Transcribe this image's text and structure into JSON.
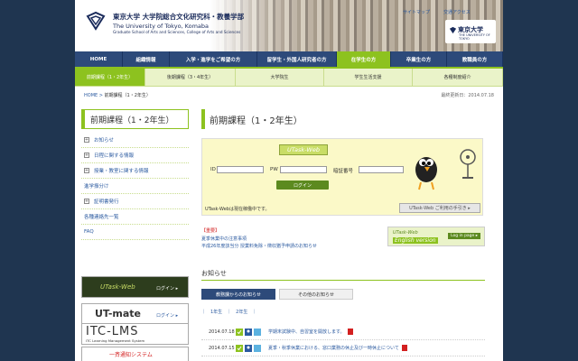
{
  "header": {
    "title_jp": "東京大学 大学院総合文化研究科・教養学部",
    "title_en": "The University of Tokyo, Komaba",
    "subtitle": "Graduate School of Arts and Sciences, College of Arts and Sciences",
    "sitemap": "サイトマップ",
    "access": "交通アクセス",
    "ut_logo": "東京大学",
    "ut_logo_sub": "THE UNIVERSITY OF TOKYO"
  },
  "nav": [
    "HOME",
    "組織情報",
    "入学・進学をご希望の方",
    "留学生・外国人研究者の方",
    "在学生の方",
    "卒業生の方",
    "教職員の方"
  ],
  "subnav": [
    "前期課程（1・2年生）",
    "後期課程（3・4年生）",
    "大学院生",
    "学生生活支援",
    "各種制度紹介"
  ],
  "breadcrumb": {
    "home": "HOME",
    "sep": " > ",
    "current": "前期課程（1・2年生）"
  },
  "updated": "最終更新日：2014.07.18",
  "sidebar": {
    "heading": "前期課程（1・2年生）",
    "items": [
      "お知らせ",
      "日程に関する情報",
      "授業・教室に関する情報",
      "進学振分け",
      "証明書発行",
      "各種連絡先一覧",
      "FAQ"
    ]
  },
  "side_banners": {
    "utask": "UTask-Web",
    "utask_login": "ログイン ▸",
    "utmate": "UT-mate",
    "utmate_login": "ログイン ▸",
    "itc": "ITC-LMS",
    "itc_sub": "ITC Learning Management System",
    "ichigo": "一斉通知システム"
  },
  "main": {
    "title": "前期課程（1・2年生）",
    "utask": {
      "logo": "UTask-Web",
      "id_label": "ID",
      "pw_label": "PW",
      "code_label": "暗証番号",
      "login": "ログイン",
      "status": "UTask-Webは現在稼働中です。",
      "use_button": "UTask-Web ご利用の手引き ▸"
    },
    "notice": {
      "tag": "【重要】",
      "l1": "夏季休業中の注意事項",
      "l2": "平成26年度該当分 授業料免除・徴収猶予申請のお知らせ"
    },
    "english": {
      "a": "UTask-Web",
      "b": "English version",
      "login": "Log in page ▸"
    },
    "news_title": "お知らせ",
    "tabs": [
      "教務課からのお知らせ",
      "その他のお知らせ"
    ],
    "years": "｜　1年生　｜　2年生　｜",
    "news": [
      {
        "date": "2014.07.18",
        "text": "学期末試験中、自習室を開放します。"
      },
      {
        "date": "2014.07.15",
        "text": "夏季・秋季休業における、窓口業務の休止及び一時休止について"
      }
    ]
  }
}
